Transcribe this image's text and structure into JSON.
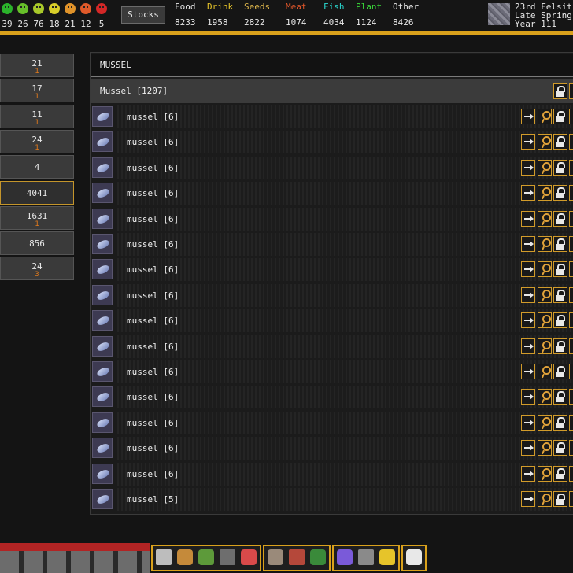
{
  "header": {
    "faces": [
      {
        "icon": "ecstatic-face-icon",
        "color": "#2bb32b",
        "count": "39"
      },
      {
        "icon": "happy-face-icon",
        "color": "#67c02a",
        "count": "26"
      },
      {
        "icon": "content-face-icon",
        "color": "#a9c92a",
        "count": "76"
      },
      {
        "icon": "fine-face-icon",
        "color": "#d9cf2a",
        "count": "18"
      },
      {
        "icon": "unhappy-face-icon",
        "color": "#e0932a",
        "count": "21"
      },
      {
        "icon": "upset-face-icon",
        "color": "#e05a2a",
        "count": "12"
      },
      {
        "icon": "miserable-face-icon",
        "color": "#d42727",
        "count": "5"
      }
    ],
    "stocks_button": "Stocks",
    "stats": [
      {
        "label": "Food",
        "value": "8233",
        "color": "#e6e6e6"
      },
      {
        "label": "Drink",
        "value": "1958",
        "color": "#e6c42a"
      },
      {
        "label": "Seeds",
        "value": "2822",
        "color": "#d9b24a"
      },
      {
        "label": "Meat",
        "value": "1074",
        "color": "#e0562a"
      },
      {
        "label": "Fish",
        "value": "4034",
        "color": "#2ad9d0"
      },
      {
        "label": "Plant",
        "value": "1124",
        "color": "#3ad93a"
      },
      {
        "label": "Other",
        "value": "8426",
        "color": "#e6e6e6"
      }
    ],
    "date": {
      "line1": "23rd Felsit",
      "line2": "Late Spring",
      "line3": "Year 111"
    }
  },
  "left_list": [
    {
      "count": "21",
      "sub": "1"
    },
    {
      "count": "17",
      "sub": "1"
    },
    {
      "count": "11",
      "sub": "1"
    },
    {
      "count": "24",
      "sub": "1"
    },
    {
      "count": "4",
      "sub": ""
    },
    {
      "count": "4041",
      "sub": ""
    },
    {
      "count": "1631",
      "sub": "1"
    },
    {
      "count": "856",
      "sub": ""
    },
    {
      "count": "24",
      "sub": "3"
    }
  ],
  "panel": {
    "title": "MUSSEL",
    "group_header": "Mussel [1207]",
    "items": [
      {
        "label": "mussel [6]"
      },
      {
        "label": "mussel [6]"
      },
      {
        "label": "mussel [6]"
      },
      {
        "label": "mussel [6]"
      },
      {
        "label": "mussel [6]"
      },
      {
        "label": "mussel [6]"
      },
      {
        "label": "mussel [6]"
      },
      {
        "label": "mussel [6]"
      },
      {
        "label": "mussel [6]"
      },
      {
        "label": "mussel [6]"
      },
      {
        "label": "mussel [6]"
      },
      {
        "label": "mussel [6]"
      },
      {
        "label": "mussel [6]"
      },
      {
        "label": "mussel [6]"
      },
      {
        "label": "mussel [6]"
      },
      {
        "label": "mussel [5]"
      }
    ]
  },
  "toolbar": {
    "tools": [
      {
        "icon": "pickaxe-icon",
        "color": "#bdbdbd"
      },
      {
        "icon": "axe-icon",
        "color": "#c58a3a"
      },
      {
        "icon": "herb-icon",
        "color": "#5d9a3a"
      },
      {
        "icon": "stone-block-icon",
        "color": "#6e6e6e"
      },
      {
        "icon": "eraser-icon",
        "color": "#d94a4a"
      },
      {
        "icon": "stairs-icon",
        "color": "#9a8a7a"
      },
      {
        "icon": "workshop-icon",
        "color": "#b5483a"
      },
      {
        "icon": "dwarf-portrait-icon",
        "color": "#3a8a3a"
      },
      {
        "icon": "zone-icon",
        "color": "#7a5ad9"
      },
      {
        "icon": "minecart-icon",
        "color": "#8a8a8a"
      },
      {
        "icon": "fast-forward-icon",
        "color": "#e6c42a"
      },
      {
        "icon": "visibility-lock-icon",
        "color": "#e8e8e8"
      }
    ]
  }
}
